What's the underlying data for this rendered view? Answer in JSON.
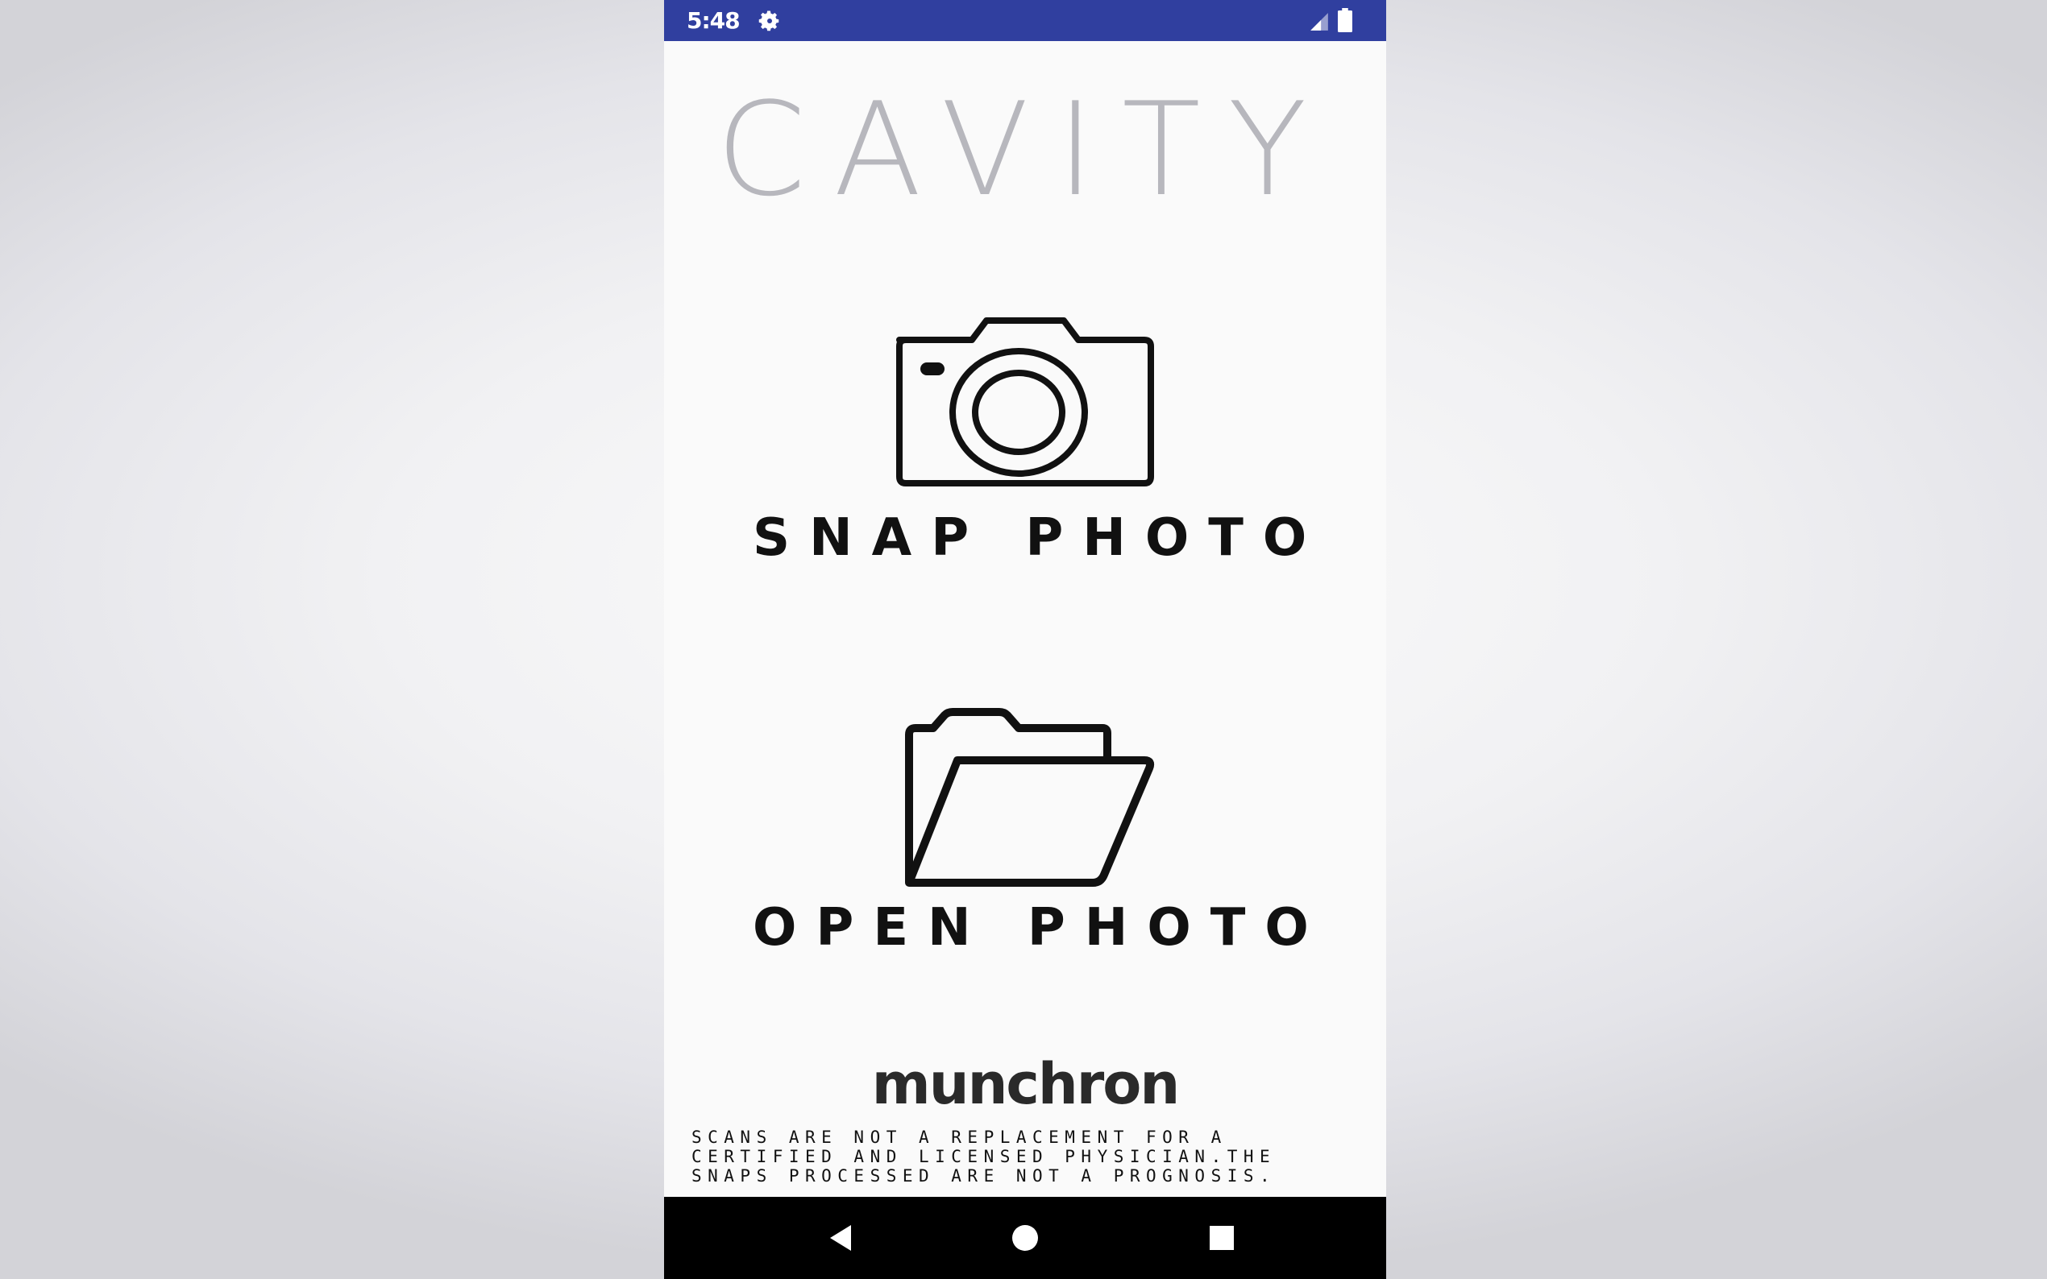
{
  "status_bar": {
    "time": "5:48",
    "background_color": "#303f9f",
    "icons": [
      "settings-gear-icon",
      "cell-signal-icon",
      "battery-icon"
    ]
  },
  "app": {
    "title": "CAVITY",
    "title_color": "#b7b7bd"
  },
  "actions": {
    "snap": {
      "label": "SNAP PHOTO",
      "icon": "camera-icon"
    },
    "open": {
      "label": "OPEN PHOTO",
      "icon": "folder-open-icon"
    }
  },
  "footer": {
    "brand": "munchron",
    "disclaimer_lines": [
      "SCANS ARE NOT A REPLACEMENT FOR A",
      "CERTIFIED AND LICENSED PHYSICIAN.THE",
      "SNAPS PROCESSED ARE NOT A PROGNOSIS."
    ]
  },
  "nav_bar": {
    "buttons": [
      "back-icon",
      "home-icon",
      "recents-icon"
    ],
    "background_color": "#000000"
  }
}
